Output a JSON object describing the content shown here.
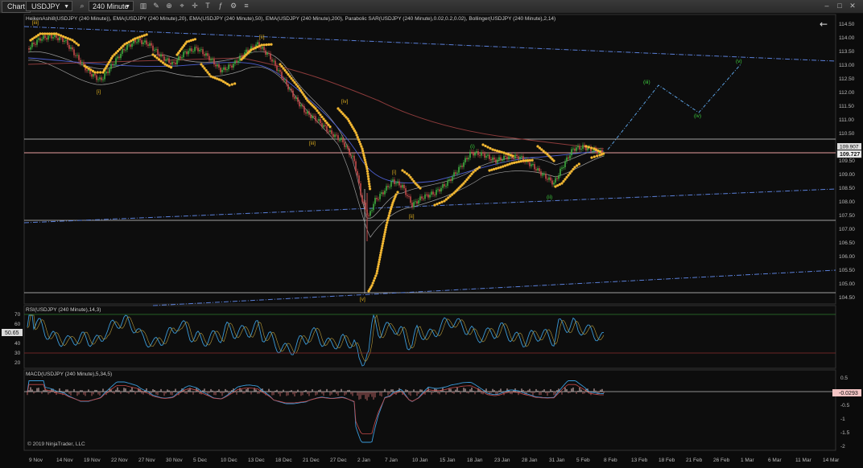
{
  "toolbar": {
    "chart_label": "Chart",
    "instrument": "USDJPY",
    "interval": "240 Minute"
  },
  "main_panel": {
    "title": "HeikenAshi8(USDJPY (240 Minute)), EMA(USDJPY (240 Minute),20), EMA(USDJPY (240 Minute),50), EMA(USDJPY (240 Minute),200), Parabolic SAR(USDJPY (240 Minute),0.02,0.2,0.02), Bollinger(USDJPY (240 Minute),2,14)",
    "price_ticks": [
      "114.50",
      "114.00",
      "113.50",
      "113.00",
      "112.50",
      "112.00",
      "111.50",
      "111.00",
      "110.50",
      "110.00",
      "109.50",
      "109.00",
      "108.50",
      "108.00",
      "107.50",
      "107.00",
      "106.50",
      "106.00",
      "105.50",
      "105.00",
      "104.50"
    ],
    "price_tag_upper": "109.907",
    "price_tag_last": "109.727",
    "wave_labels": [
      "[i]",
      "[ii]",
      "[iii]",
      "[iv]",
      "[v]",
      "(i)",
      "[ii]",
      "(ii)",
      "[i]",
      "[iii]"
    ],
    "wave_labels_projected": [
      "(iii)",
      "(iv)",
      "(v)"
    ]
  },
  "rsi_panel": {
    "title": "RSI(USDJPY (240 Minute),14,3)",
    "ticks": [
      "70",
      "60",
      "50",
      "40",
      "30",
      "20"
    ],
    "current_value": "50.65"
  },
  "macd_panel": {
    "title": "MACD(USDJPY (240 Minute),5,34,5)",
    "ticks": [
      "0.5",
      "0",
      "-0.5",
      "-1",
      "-1.5",
      "-2"
    ],
    "current_value": "-0.0293"
  },
  "date_axis": [
    "9 Nov",
    "14 Nov",
    "19 Nov",
    "22 Nov",
    "27 Nov",
    "30 Nov",
    "5 Dec",
    "10 Dec",
    "13 Dec",
    "18 Dec",
    "21 Dec",
    "27 Dec",
    "2 Jan",
    "7 Jan",
    "10 Jan",
    "15 Jan",
    "18 Jan",
    "23 Jan",
    "28 Jan",
    "31 Jan",
    "5 Feb",
    "8 Feb",
    "13 Feb",
    "18 Feb",
    "21 Feb",
    "26 Feb",
    "1 Mar",
    "6 Mar",
    "11 Mar",
    "14 Mar"
  ],
  "copyright": "© 2019 NinjaTrader, LLC",
  "colors": {
    "background": "#0b0b0b",
    "bull_candle": "#3fae3f",
    "bear_candle": "#c44a4a",
    "sar_dots": "#f2b732",
    "trendline_blue": "#5a7fd8",
    "wave_green": "#3fd13f",
    "wave_yellow": "#e0b020"
  },
  "icons": [
    "search-icon",
    "zoom-icon",
    "pointer-icon",
    "settings-icon",
    "back-arrow-icon"
  ]
}
